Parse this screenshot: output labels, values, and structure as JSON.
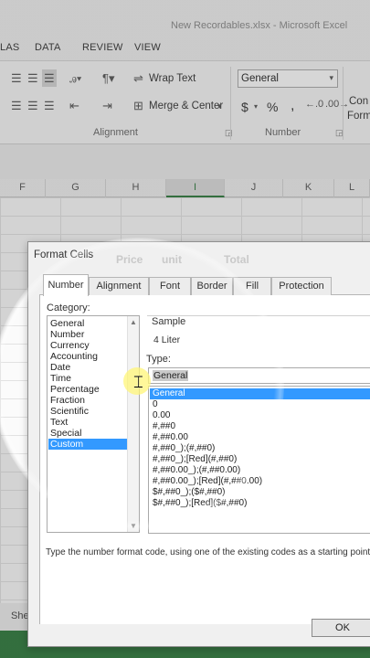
{
  "window": {
    "title": "New Recordables.xlsx - Microsoft Excel"
  },
  "ribbon_tabs": [
    "LAS",
    "DATA",
    "REVIEW",
    "VIEW"
  ],
  "ribbon": {
    "wrap_text": "Wrap Text",
    "merge_center": "Merge & Center",
    "number_format": "General",
    "alignment_group": "Alignment",
    "number_group": "Number",
    "currency_symbol": "$",
    "percent_symbol": "%",
    "comma_symbol": ",",
    "cond_format_partial": "Con",
    "format_partial": "Form"
  },
  "columns": [
    "F",
    "G",
    "H",
    "I",
    "J",
    "K",
    "L"
  ],
  "selected_column": "I",
  "sheet_tab_partial": "She",
  "dialog": {
    "title": "Format Cells",
    "background_ghost_text": [
      "Price",
      "unit",
      "Total"
    ],
    "tabs": [
      "Number",
      "Alignment",
      "Font",
      "Border",
      "Fill",
      "Protection"
    ],
    "active_tab": "Number",
    "category_label": "Category:",
    "categories": [
      "General",
      "Number",
      "Currency",
      "Accounting",
      "Date",
      "Time",
      "Percentage",
      "Fraction",
      "Scientific",
      "Text",
      "Special",
      "Custom"
    ],
    "selected_category": "Custom",
    "sample_label": "Sample",
    "sample_value": "4 Liter",
    "type_label": "Type:",
    "type_value": "General",
    "formats": [
      "General",
      "0",
      "0.00",
      "#,##0",
      "#,##0.00",
      "#,##0_);(#,##0)",
      "#,##0_);[Red](#,##0)",
      "#,##0.00_);(#,##0.00)",
      "#,##0.00_);[Red](#,##0.00)",
      "$#,##0_);($#,##0)",
      "$#,##0_);[Red]($#,##0)"
    ],
    "selected_format": "General",
    "hint": "Type the number format code, using one of the existing codes as a starting point.",
    "ok_label": "OK"
  },
  "colors": {
    "accent": "#2e7a3c",
    "selection": "#3399ff"
  }
}
